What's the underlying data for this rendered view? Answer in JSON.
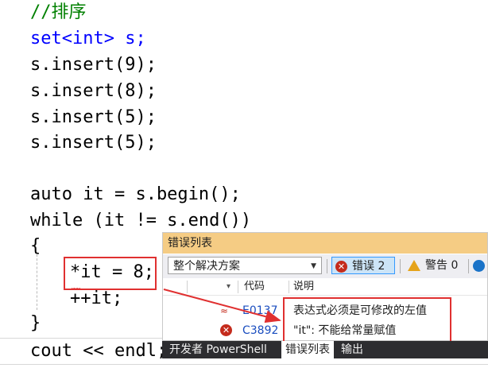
{
  "editor": {
    "lines": [
      "//排序",
      "set<int> s;",
      "s.insert(9);",
      "s.insert(8);",
      "s.insert(5);",
      "s.insert(5);",
      "auto it = s.begin();",
      "while (it != s.end())",
      "{",
      "*it = 8;",
      "++it;",
      "}",
      "cout << endl;"
    ]
  },
  "error_panel": {
    "title": "错误列表",
    "scope_value": "整个解决方案",
    "errors_label": "错误 2",
    "warnings_label": "警告 0",
    "columns": {
      "code": "代码",
      "description": "说明"
    },
    "rows": [
      {
        "code": "E0137",
        "description": "表达式必须是可修改的左值"
      },
      {
        "code": "C3892",
        "description": "\"it\": 不能给常量赋值"
      }
    ],
    "tabs": [
      "开发者 PowerShell",
      "错误列表",
      "输出"
    ]
  },
  "colors": {
    "title_bar": "#f5cc84",
    "error_red": "#c42b1c",
    "annotation_red": "#e03030",
    "keyword_blue": "#0000ff"
  }
}
